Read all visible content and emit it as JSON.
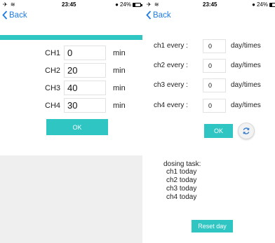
{
  "left": {
    "status": {
      "time": "23:45",
      "battery": "24%"
    },
    "nav": {
      "back_label": "Back"
    },
    "channels": [
      {
        "label": "CH1",
        "value": "0",
        "unit": "min"
      },
      {
        "label": "CH2",
        "value": "20",
        "unit": "min"
      },
      {
        "label": "CH3",
        "value": "40",
        "unit": "min"
      },
      {
        "label": "CH4",
        "value": "30",
        "unit": "min"
      }
    ],
    "ok_label": "OK"
  },
  "right": {
    "status": {
      "time": "23:45",
      "battery": "24%"
    },
    "nav": {
      "back_label": "Back"
    },
    "schedule": [
      {
        "label": "ch1 every :",
        "value": "0",
        "unit": "day/times"
      },
      {
        "label": "ch2 every :",
        "value": "0",
        "unit": "day/times"
      },
      {
        "label": "ch3 every :",
        "value": "0",
        "unit": "day/times"
      },
      {
        "label": "ch4 every :",
        "value": "0",
        "unit": "day/times"
      }
    ],
    "ok_label": "OK",
    "task": {
      "title": "dosing task:",
      "items": [
        "ch1 today",
        "ch2 today",
        "ch3 today",
        "ch4 today"
      ]
    },
    "reset_label": "Reset day"
  },
  "colors": {
    "accent": "#2ec5c2",
    "link": "#1e7ce6",
    "panel_gray": "#efefef"
  },
  "icons": [
    "airplane-icon",
    "wifi-icon",
    "alarm-icon",
    "battery-icon",
    "chevron-left-icon",
    "refresh-icon"
  ]
}
